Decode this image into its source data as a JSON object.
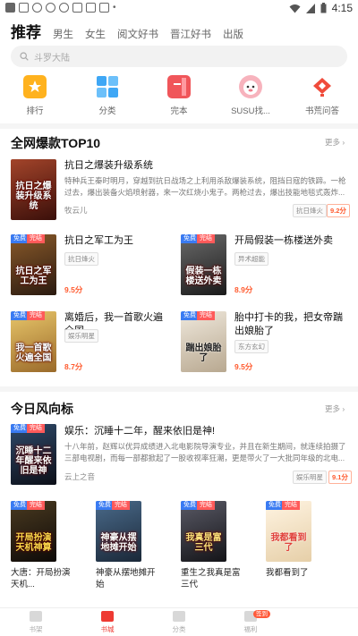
{
  "status_bar": {
    "time": "4:15"
  },
  "top_tabs": {
    "active": "推荐",
    "others": [
      "男生",
      "女生",
      "阅文好书",
      "晋江好书",
      "出版"
    ]
  },
  "search": {
    "placeholder": "斗罗大陆"
  },
  "categories": [
    {
      "label": "排行",
      "icon": "ranking-icon",
      "color": "#ffb21e"
    },
    {
      "label": "分类",
      "icon": "category-grid-icon",
      "color": "#3fa7f5"
    },
    {
      "label": "完本",
      "icon": "finished-book-icon",
      "color": "#f0565a"
    },
    {
      "label": "SUSU找...",
      "icon": "susu-avatar-icon",
      "color": "#f07c8a"
    },
    {
      "label": "书荒问答",
      "icon": "book-qa-icon",
      "color": "#f04b3b"
    }
  ],
  "section1": {
    "title": "全网爆款TOP10",
    "more": "更多",
    "featured": {
      "title": "抗日之爆装升级系统",
      "desc": "特种兵王秦时明月，穿越到抗日战场之上利用杀敌爆装系统，阻挡日寇的铁蹄。一枪过去，爆出装备火焰喷射器，来一次红烧小鬼子。两枪过去，爆出技能地毯式轰炸...",
      "author": "牧云儿",
      "tag": "抗日烽火",
      "score": "9.2分",
      "cover_text": "抗日之爆装升级系统",
      "cover_bg": "#5a1e14"
    },
    "grid": [
      {
        "title": "抗日之军工为王",
        "tag": "抗日烽火",
        "score": "9.5分",
        "badges": [
          "免费",
          "完结"
        ],
        "cover_text": "抗日之军工为王",
        "cover_bg": "#4a3322"
      },
      {
        "title": "开局假装一栋楼送外卖",
        "tag": "异术超能",
        "score": "8.9分",
        "badges": [
          "免费",
          "完结"
        ],
        "cover_text": "假装一栋楼送外卖",
        "cover_bg": "#3a3a3a"
      },
      {
        "title": "离婚后，我一首歌火遍全国",
        "tag": "娱乐明星",
        "score": "8.7分",
        "badges": [
          "免费",
          "完结"
        ],
        "cover_text": "我一首歌火遍全国",
        "cover_bg": "#c8a24a"
      },
      {
        "title": "胎中打卡的我，把女帝踹出娘胎了",
        "tag": "东方玄幻",
        "score": "9.5分",
        "badges": [
          "免费",
          "完结"
        ],
        "cover_text": "踹出娘胎了",
        "cover_bg": "#d9d2c4"
      }
    ]
  },
  "section2": {
    "title": "今日风向标",
    "more": "更多",
    "featured": {
      "title": "娱乐：沉睡十二年，醒来依旧是神!",
      "desc": "十八年前，赵辉以优异成绩进入北电影院导演专业，并且在新生期间，就连续拍摄了三部电视剧，而每一部都掀起了一股收视率狂潮，更是带火了一大批同年级的北电...",
      "author": "云上之音",
      "tag": "娱乐明星",
      "score": "9.1分",
      "badges": [
        "免费",
        "完结"
      ],
      "cover_text": "沉睡十二年醒来依旧是神",
      "cover_bg": "#1c2230"
    },
    "grid": [
      {
        "title": "大唐：开局扮演天机...",
        "badges": [
          "免费",
          "完结"
        ],
        "cover_text": "开局扮演天机神算",
        "cover_bg": "#1a1a1a"
      },
      {
        "title": "神豪从摆地摊开始",
        "badges": [
          "免费",
          "完结"
        ],
        "cover_text": "神豪从摆地摊开始",
        "cover_bg": "#26384a"
      },
      {
        "title": "重生之我真是富三代",
        "badges": [
          "免费",
          "完结"
        ],
        "cover_text": "我真是富三代",
        "cover_bg": "#2b2a30"
      },
      {
        "title": "我都看到了",
        "badges": [
          "免费",
          "完结"
        ],
        "cover_text": "我都看到了",
        "cover_bg": "#f3e6d0"
      }
    ]
  },
  "bottom_nav": {
    "items": [
      {
        "label": "书架",
        "icon": "bookshelf-icon"
      },
      {
        "label": "书城",
        "icon": "bookstore-icon"
      },
      {
        "label": "分类",
        "icon": "category-icon"
      },
      {
        "label": "福利",
        "icon": "gift-icon"
      }
    ],
    "active": "书城",
    "welfare_badge": "签到"
  }
}
